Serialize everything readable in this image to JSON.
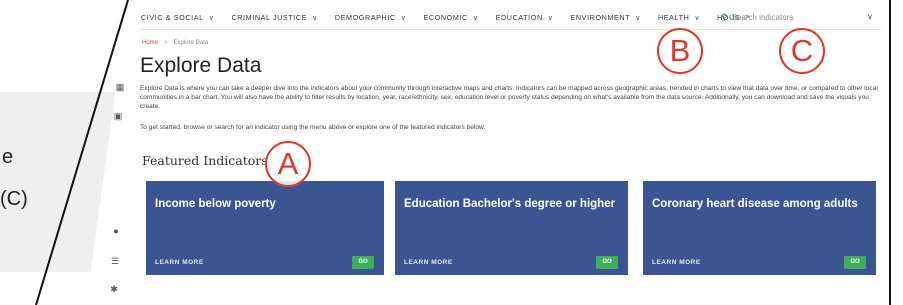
{
  "callout": {
    "line1": "e",
    "line2": "(C)"
  },
  "nav": {
    "items": [
      {
        "label": "CIVIC & SOCIAL"
      },
      {
        "label": "CRIMINAL JUSTICE"
      },
      {
        "label": "DEMOGRAPHIC"
      },
      {
        "label": "ECONOMIC"
      },
      {
        "label": "EDUCATION"
      },
      {
        "label": "ENVIRONMENT"
      },
      {
        "label": "HEALTH"
      }
    ],
    "last_item": "HOUS",
    "last_chevron": ">",
    "chevron": "∨",
    "search_placeholder": "Search indicators",
    "search_icon": "search-icon"
  },
  "breadcrumb": {
    "home": "Home",
    "separator": ">",
    "current": "Explore Data"
  },
  "page": {
    "title": "Explore Data",
    "intro": "Explore Data is where you can take a deeper dive into the indicators about your community through interactive maps and charts. Indicators can be mapped across geographic areas, trended in charts to view that data over time, or compared to other local communities in a bar chart. You will also have the ability to filter results by location, year, race/ethnicity, sex, education level or poverty status depending on what's available from the data source. Additionally, you can download and save the visuals you create.",
    "intro2": "To get started, browse or search for an indicator using the menu above or explore one of the featured indicators below.",
    "featured_heading": "Featured Indicators"
  },
  "cards": [
    {
      "title": "Income below poverty",
      "learn_more": "LEARN MORE",
      "go": "GO"
    },
    {
      "title": "Education Bachelor's degree or higher",
      "learn_more": "LEARN MORE",
      "go": "GO"
    },
    {
      "title": "Coronary heart disease among adults",
      "learn_more": "LEARN MORE",
      "go": "GO"
    }
  ],
  "annotations": {
    "a": "A",
    "b": "B",
    "c": "C"
  },
  "colors": {
    "card_bg": "#3b5593",
    "go_button": "#3fae59",
    "annotation": "#e0392b",
    "breadcrumb_home": "#dd4444"
  },
  "rail_icons": [
    "chart-icon",
    "map-icon",
    "info-icon",
    "database-icon",
    "tools-icon"
  ]
}
